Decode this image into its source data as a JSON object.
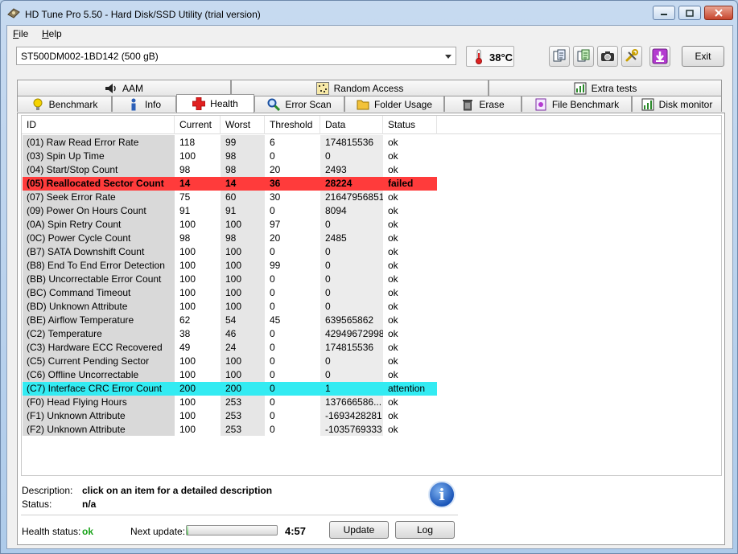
{
  "window": {
    "title": "HD Tune Pro 5.50 - Hard Disk/SSD Utility (trial version)"
  },
  "menu": {
    "items": [
      {
        "first": "F",
        "rest": "ile"
      },
      {
        "first": "H",
        "rest": "elp"
      }
    ]
  },
  "toolbar": {
    "drive": "ST500DM002-1BD142 (500 gB)",
    "temperature": "38°C",
    "exit_label": "Exit"
  },
  "tabs_top": [
    {
      "label": "AAM",
      "icon": "speaker-icon"
    },
    {
      "label": "Random Access",
      "icon": "dots-grid-icon"
    },
    {
      "label": "Extra tests",
      "icon": "tests-icon"
    }
  ],
  "tabs_bottom": [
    {
      "label": "Benchmark",
      "icon": "bulb-icon"
    },
    {
      "label": "Info",
      "icon": "info-figure-icon"
    },
    {
      "label": "Health",
      "icon": "red-cross-icon",
      "active": true
    },
    {
      "label": "Error Scan",
      "icon": "magnifier-icon"
    },
    {
      "label": "Folder Usage",
      "icon": "folder-icon"
    },
    {
      "label": "Erase",
      "icon": "trash-icon"
    },
    {
      "label": "File Benchmark",
      "icon": "file-bench-icon"
    },
    {
      "label": "Disk monitor",
      "icon": "monitor-chart-icon"
    }
  ],
  "table": {
    "headers": [
      "ID",
      "Current",
      "Worst",
      "Threshold",
      "Data",
      "Status"
    ],
    "rows": [
      {
        "id": "(01) Raw Read Error Rate",
        "current": "118",
        "worst": "99",
        "threshold": "6",
        "data": "174815536",
        "status": "ok"
      },
      {
        "id": "(03) Spin Up Time",
        "current": "100",
        "worst": "98",
        "threshold": "0",
        "data": "0",
        "status": "ok"
      },
      {
        "id": "(04) Start/Stop Count",
        "current": "98",
        "worst": "98",
        "threshold": "20",
        "data": "2493",
        "status": "ok"
      },
      {
        "id": "(05) Reallocated Sector Count",
        "current": "14",
        "worst": "14",
        "threshold": "36",
        "data": "28224",
        "status": "failed",
        "flag": "failed"
      },
      {
        "id": "(07) Seek Error Rate",
        "current": "75",
        "worst": "60",
        "threshold": "30",
        "data": "21647956851",
        "status": "ok"
      },
      {
        "id": "(09) Power On Hours Count",
        "current": "91",
        "worst": "91",
        "threshold": "0",
        "data": "8094",
        "status": "ok"
      },
      {
        "id": "(0A) Spin Retry Count",
        "current": "100",
        "worst": "100",
        "threshold": "97",
        "data": "0",
        "status": "ok"
      },
      {
        "id": "(0C) Power Cycle Count",
        "current": "98",
        "worst": "98",
        "threshold": "20",
        "data": "2485",
        "status": "ok"
      },
      {
        "id": "(B7) SATA Downshift Count",
        "current": "100",
        "worst": "100",
        "threshold": "0",
        "data": "0",
        "status": "ok"
      },
      {
        "id": "(B8) End To End Error Detection",
        "current": "100",
        "worst": "100",
        "threshold": "99",
        "data": "0",
        "status": "ok"
      },
      {
        "id": "(BB) Uncorrectable Error Count",
        "current": "100",
        "worst": "100",
        "threshold": "0",
        "data": "0",
        "status": "ok"
      },
      {
        "id": "(BC) Command Timeout",
        "current": "100",
        "worst": "100",
        "threshold": "0",
        "data": "0",
        "status": "ok"
      },
      {
        "id": "(BD) Unknown Attribute",
        "current": "100",
        "worst": "100",
        "threshold": "0",
        "data": "0",
        "status": "ok"
      },
      {
        "id": "(BE) Airflow Temperature",
        "current": "62",
        "worst": "54",
        "threshold": "45",
        "data": "639565862",
        "status": "ok"
      },
      {
        "id": "(C2) Temperature",
        "current": "38",
        "worst": "46",
        "threshold": "0",
        "data": "42949672998",
        "status": "ok"
      },
      {
        "id": "(C3) Hardware ECC Recovered",
        "current": "49",
        "worst": "24",
        "threshold": "0",
        "data": "174815536",
        "status": "ok"
      },
      {
        "id": "(C5) Current Pending Sector",
        "current": "100",
        "worst": "100",
        "threshold": "0",
        "data": "0",
        "status": "ok"
      },
      {
        "id": "(C6) Offline Uncorrectable",
        "current": "100",
        "worst": "100",
        "threshold": "0",
        "data": "0",
        "status": "ok"
      },
      {
        "id": "(C7) Interface CRC Error Count",
        "current": "200",
        "worst": "200",
        "threshold": "0",
        "data": "1",
        "status": "attention",
        "flag": "attention"
      },
      {
        "id": "(F0) Head Flying Hours",
        "current": "100",
        "worst": "253",
        "threshold": "0",
        "data": "137666586...",
        "status": "ok"
      },
      {
        "id": "(F1) Unknown Attribute",
        "current": "100",
        "worst": "253",
        "threshold": "0",
        "data": "-1693428281",
        "status": "ok"
      },
      {
        "id": "(F2) Unknown Attribute",
        "current": "100",
        "worst": "253",
        "threshold": "0",
        "data": "-1035769333",
        "status": "ok"
      }
    ]
  },
  "details": {
    "description_label": "Description:",
    "description_value": "click on an item for a detailed description",
    "status_label": "Status:",
    "status_value": "n/a"
  },
  "footer": {
    "health_label": "Health status:",
    "health_value": "ok",
    "next_update_label": "Next update:",
    "next_update_value": "4:57",
    "progress_fraction": 0.02,
    "update_label": "Update",
    "log_label": "Log"
  },
  "colors": {
    "failed_row": "#ff3b3b",
    "attention_row": "#33ebf2",
    "health_ok": "#1aa31a"
  }
}
